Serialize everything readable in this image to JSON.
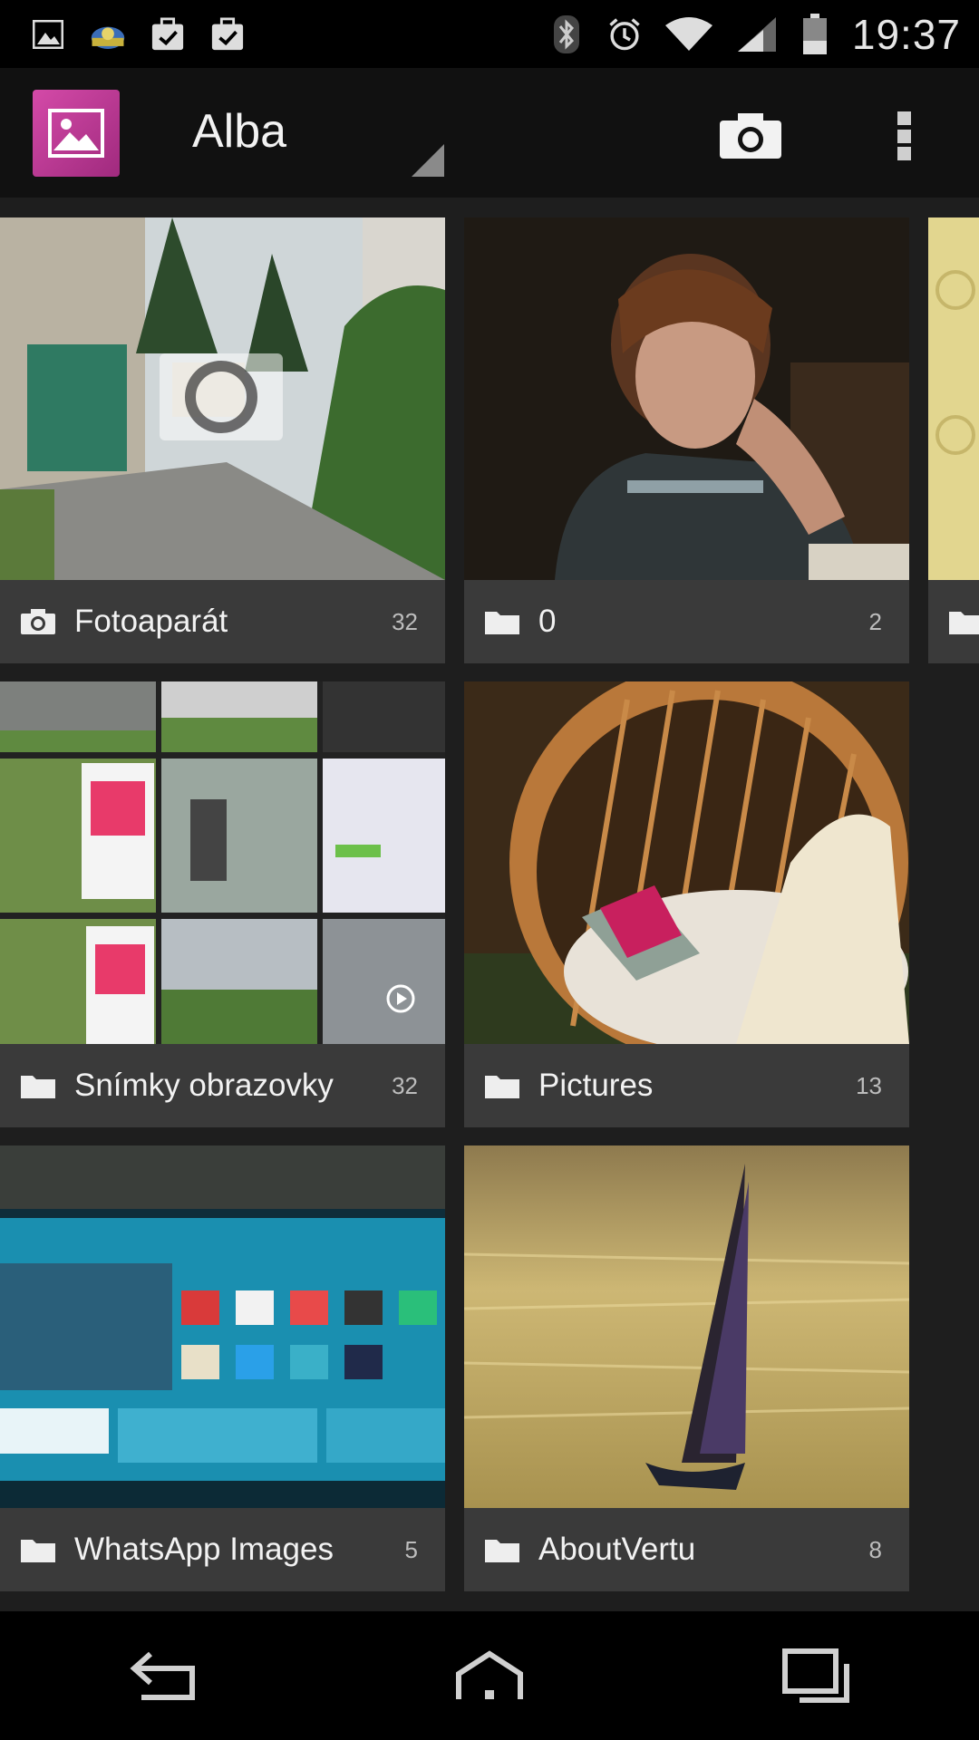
{
  "status_bar": {
    "time": "19:37",
    "notification_icons": [
      "image-icon",
      "weather-icon",
      "clipboard-check-icon",
      "clipboard-check-icon"
    ],
    "system_icons": [
      "bluetooth-icon",
      "alarm-icon",
      "wifi-icon",
      "signal-icon",
      "battery-icon"
    ]
  },
  "action_bar": {
    "title": "Alba",
    "camera_icon": "camera-icon",
    "overflow_icon": "overflow-menu-icon"
  },
  "albums": [
    {
      "name": "Fotoaparát",
      "count": "32",
      "icon": "camera-icon"
    },
    {
      "name": "0",
      "count": "2",
      "icon": "folder-icon"
    },
    {
      "name": "Snímky obrazovky",
      "count": "32",
      "icon": "folder-icon"
    },
    {
      "name": "Pictures",
      "count": "13",
      "icon": "folder-icon"
    },
    {
      "name": "WhatsApp Images",
      "count": "5",
      "icon": "folder-icon"
    },
    {
      "name": "AboutVertu",
      "count": "8",
      "icon": "folder-icon"
    }
  ],
  "nav_bar": {
    "icons": [
      "back-icon",
      "home-icon",
      "recent-apps-icon"
    ]
  },
  "colors": {
    "app_icon_accent": "#c23a97",
    "background": "#1e1e1e",
    "label_bar": "#3a3a3a"
  }
}
